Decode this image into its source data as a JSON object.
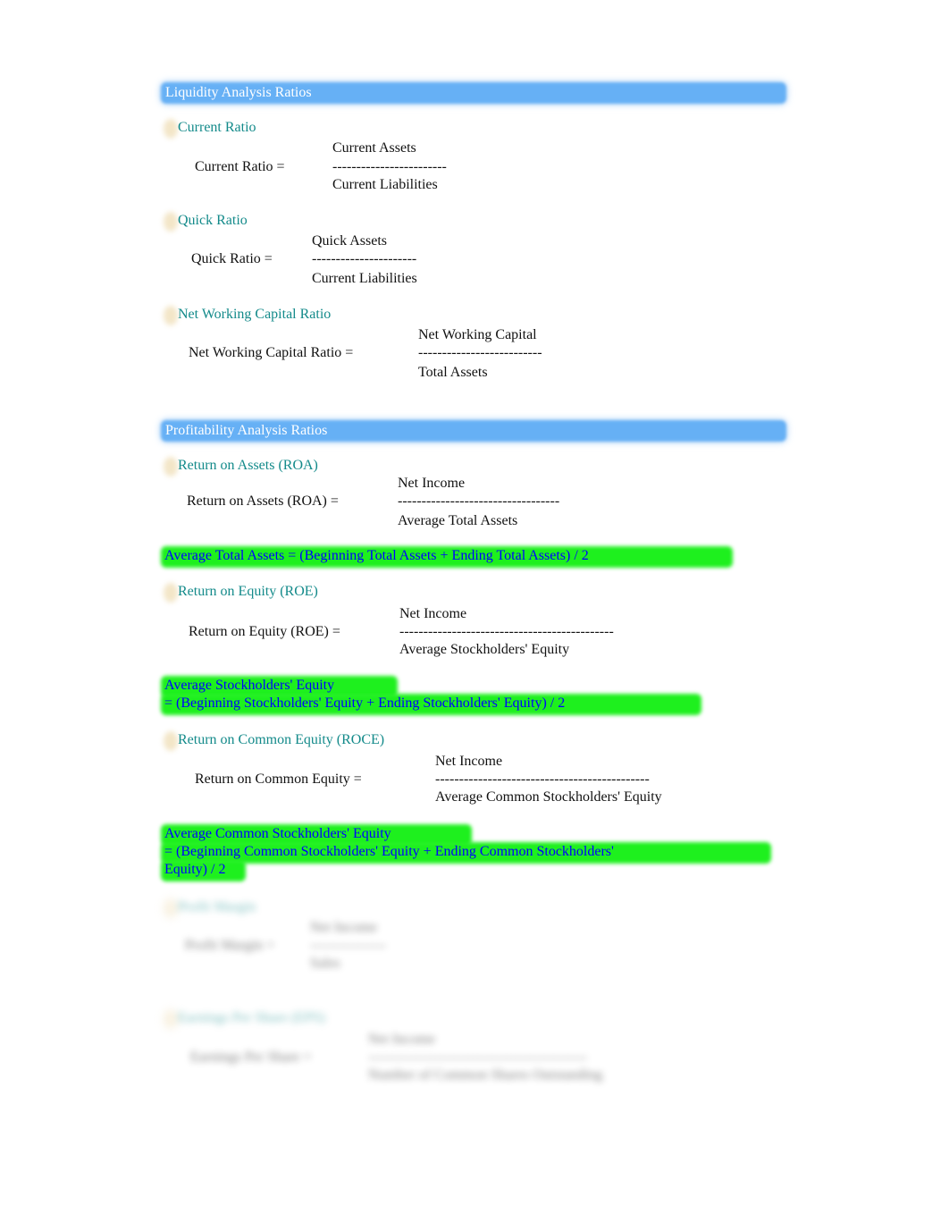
{
  "sections": {
    "liquidity": "Liquidity Analysis Ratios",
    "profitability": "Profitability Analysis Ratios"
  },
  "ratios": {
    "current": {
      "heading": "Current Ratio",
      "label": "Current Ratio =",
      "num": "Current Assets",
      "line": "------------------------",
      "den": "Current Liabilities"
    },
    "quick": {
      "heading": "Quick Ratio",
      "label": "Quick Ratio =",
      "num": "Quick Assets",
      "line": "----------------------",
      "den": "Current Liabilities"
    },
    "nwc": {
      "heading": "Net Working Capital Ratio",
      "label": "Net Working Capital Ratio =",
      "num": "Net Working Capital",
      "line": "--------------------------",
      "den": "Total Assets"
    },
    "roa": {
      "heading": "Return on Assets (ROA)",
      "label": "Return on Assets (ROA) =",
      "num": "Net Income",
      "line": "----------------------------------",
      "den": "Average Total Assets"
    },
    "roe": {
      "heading": "Return on Equity (ROE)",
      "label": "Return on Equity (ROE) =",
      "num": "Net Income",
      "line": "---------------------------------------------",
      "den": "Average Stockholders' Equity"
    },
    "roce": {
      "heading": "Return on Common Equity (ROCE)",
      "label": "Return on Common Equity =",
      "num": "Net Income",
      "line": "---------------------------------------------",
      "den": "Average Common Stockholders' Equity"
    },
    "pm": {
      "heading": "Profit Margin",
      "label": "Profit Margin =",
      "num": "Net Income",
      "line": "----------------",
      "den": "Sales"
    },
    "eps": {
      "heading": "Earnings Per Share (EPS)",
      "label": "Earnings Per Share =",
      "num": "Net Income",
      "line": "----------------------------------------------",
      "den": "Number of Common Shares Outstanding"
    }
  },
  "notes": {
    "ata": "Average Total Assets = (Beginning Total Assets + Ending Total Assets) / 2",
    "ase1": "Average Stockholders' Equity",
    "ase2": "= (Beginning Stockholders' Equity + Ending Stockholders' Equity) / 2",
    "acse1": "Average Common Stockholders' Equity",
    "acse2": "= (Beginning Common Stockholders' Equity + Ending Common Stockholders'",
    "acse3": "Equity) / 2"
  },
  "colors": {
    "band": "#66b0f5",
    "heading": "#138a8a",
    "highlight": "#1ef01e",
    "highlight_text": "#0000ff"
  }
}
